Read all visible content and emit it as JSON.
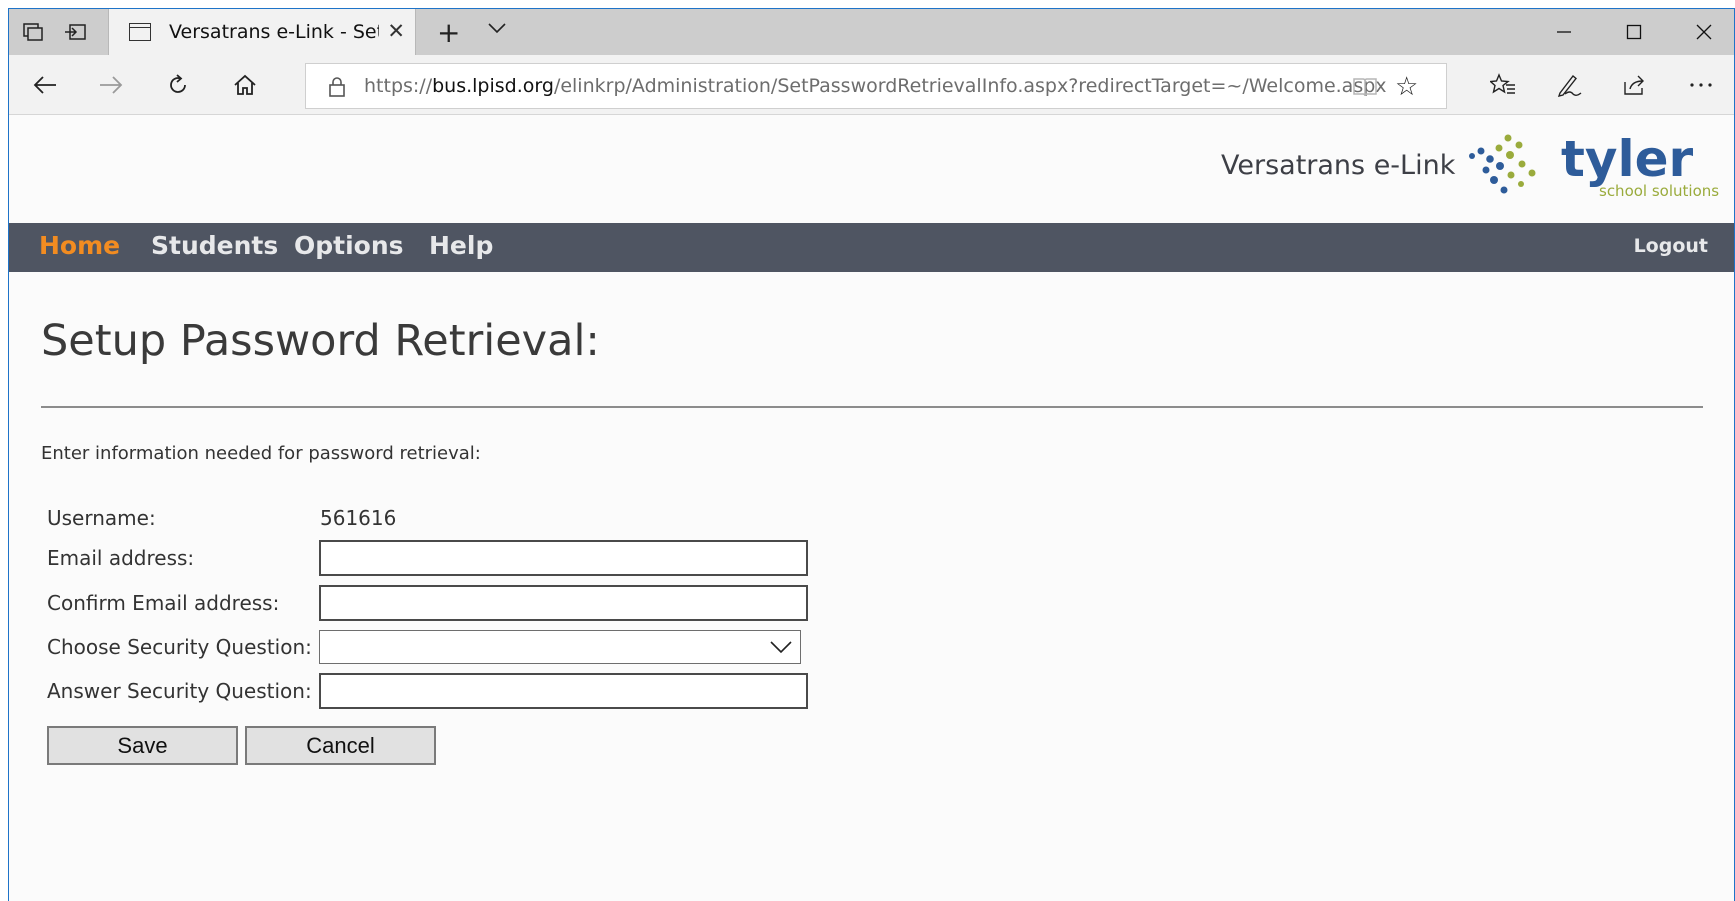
{
  "browser": {
    "tab_title": "Versatrans e-Link - Setu",
    "url_prefix": "https://",
    "url_host": "bus.lpisd.org",
    "url_path": "/elinkrp/Administration/SetPasswordRetrievalInfo.aspx?redirectTarget=~/Welcome.aspx"
  },
  "header": {
    "brand": "Versatrans e-Link",
    "logo_word": "tyler",
    "logo_sub": "school solutions",
    "colors": {
      "nav_bg": "#4f5562",
      "active": "#f28c21",
      "logo_blue": "#2e5c9a",
      "logo_green": "#9aab3c"
    }
  },
  "nav": {
    "items": [
      {
        "label": "Home",
        "active": true
      },
      {
        "label": "Students",
        "active": false
      },
      {
        "label": "Options",
        "active": false
      },
      {
        "label": "Help",
        "active": false
      }
    ],
    "logout": "Logout"
  },
  "main": {
    "title": "Setup Password Retrieval:",
    "intro": "Enter information needed for password retrieval:",
    "form": {
      "username_label": "Username:",
      "username_value": "561616",
      "email_label": "Email address:",
      "email_value": "",
      "confirm_label": "Confirm Email address:",
      "confirm_value": "",
      "question_label": "Choose Security Question:",
      "question_value": "",
      "answer_label": "Answer Security Question:",
      "answer_value": ""
    },
    "buttons": {
      "save": "Save",
      "cancel": "Cancel"
    }
  }
}
